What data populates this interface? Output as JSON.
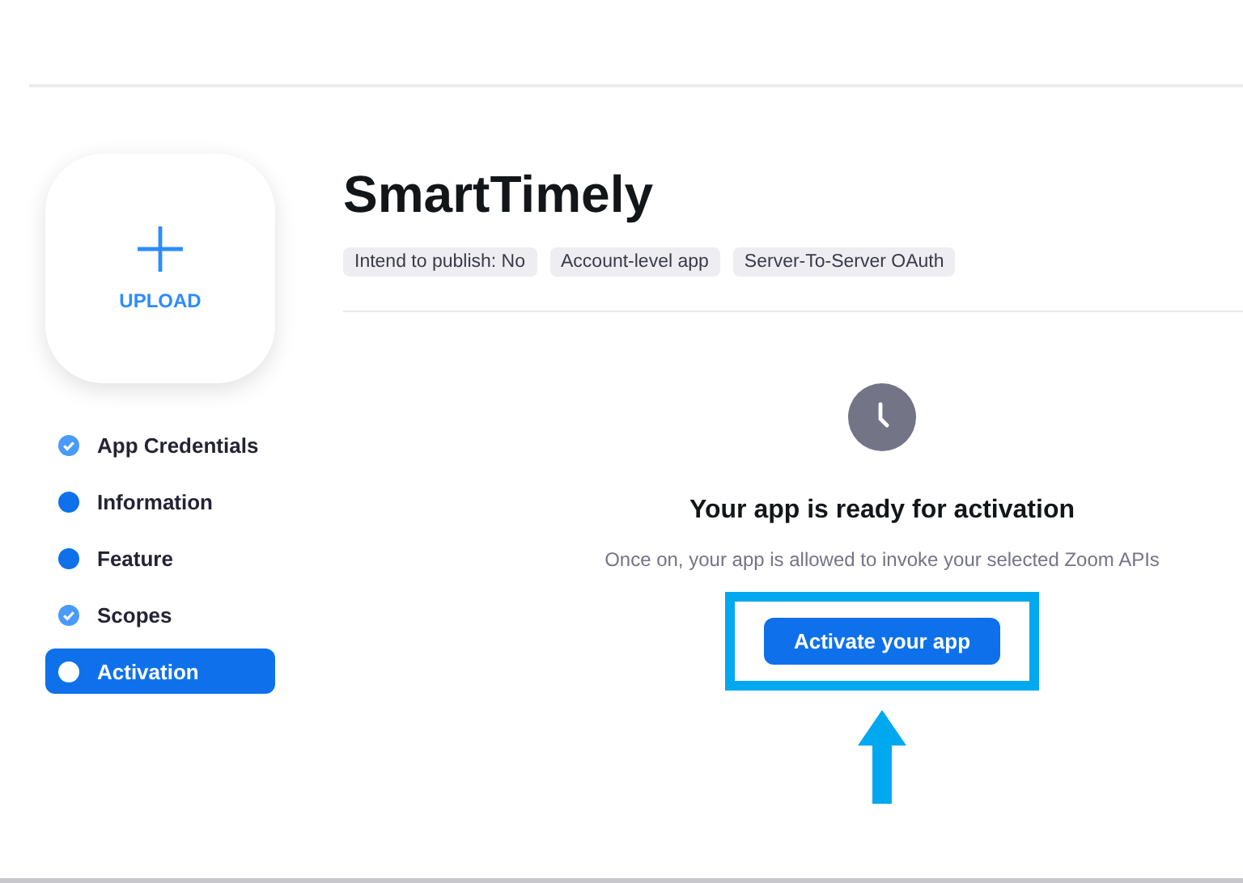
{
  "upload": {
    "label": "UPLOAD"
  },
  "steps": [
    {
      "label": "App Credentials",
      "kind": "done",
      "selected": false
    },
    {
      "label": "Information",
      "kind": "dot",
      "selected": false
    },
    {
      "label": "Feature",
      "kind": "dot",
      "selected": false
    },
    {
      "label": "Scopes",
      "kind": "done",
      "selected": false
    },
    {
      "label": "Activation",
      "kind": "dot",
      "selected": true
    }
  ],
  "app": {
    "title": "SmartTimely",
    "tags": [
      "Intend to publish: No",
      "Account-level app",
      "Server-To-Server OAuth"
    ]
  },
  "activation": {
    "heading": "Your app is ready for activation",
    "description": "Once on, your app is allowed to invoke your selected Zoom APIs",
    "button": "Activate your app",
    "highlighted": true
  }
}
